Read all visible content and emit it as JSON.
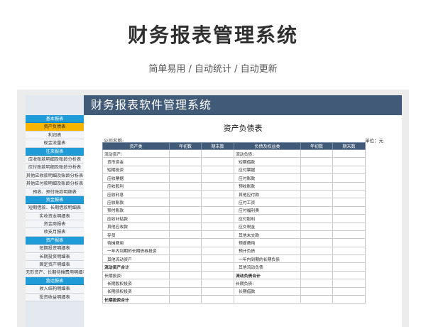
{
  "hero": {
    "title": "财务报表管理系统",
    "subtitle": "简单易用 / 自动统计 / 自动更新"
  },
  "app": {
    "banner_title": "财务报表软件管理系统",
    "sidebar": [
      {
        "label": "基本报表",
        "kind": "header"
      },
      {
        "label": "资产负债表",
        "kind": "active"
      },
      {
        "label": "利润表",
        "kind": "item"
      },
      {
        "label": "现金流量表",
        "kind": "item"
      },
      {
        "label": "往来报表",
        "kind": "header"
      },
      {
        "label": "应收账款明细及账龄分析表",
        "kind": "item"
      },
      {
        "label": "应付账款明细及账龄分析表",
        "kind": "item"
      },
      {
        "label": "其他应收款明细及账龄分析表",
        "kind": "item"
      },
      {
        "label": "其他应付款明细及账龄分析表",
        "kind": "item"
      },
      {
        "label": "预收、预付账款明细表",
        "kind": "item"
      },
      {
        "label": "资金报表",
        "kind": "header"
      },
      {
        "label": "短期借款、长期借款明细表",
        "kind": "item"
      },
      {
        "label": "实收资本明细表",
        "kind": "item"
      },
      {
        "label": "资金周报表",
        "kind": "item"
      },
      {
        "label": "收支月报表",
        "kind": "item"
      },
      {
        "label": "资产报表",
        "kind": "header"
      },
      {
        "label": "短期投资明细表",
        "kind": "item"
      },
      {
        "label": "长期投资明细表",
        "kind": "item"
      },
      {
        "label": "固定资产明细表",
        "kind": "item"
      },
      {
        "label": "无形资产、长期待摊费用明细表",
        "kind": "item"
      },
      {
        "label": "营运报表",
        "kind": "header"
      },
      {
        "label": "收入结构明细表",
        "kind": "item"
      },
      {
        "label": "投资收益明细表",
        "kind": "item"
      }
    ],
    "sheet": {
      "title": "资产负债表",
      "company_label": "公司名称:",
      "unit_label": "单位：元",
      "columns": [
        "资产类",
        "年初数",
        "期末数",
        "负债及权益类",
        "年初数",
        "期末数"
      ],
      "rows": [
        {
          "left": "流动资产:",
          "left_style": "",
          "right": "流动负债:",
          "right_style": ""
        },
        {
          "left": "货币资金",
          "left_style": "ind",
          "right": "短期借款",
          "right_style": "ind"
        },
        {
          "left": "短期投资",
          "left_style": "ind",
          "right": "应付票据",
          "right_style": "ind"
        },
        {
          "left": "应收票据",
          "left_style": "ind",
          "right": "应付账款",
          "right_style": "ind"
        },
        {
          "left": "应收股利",
          "left_style": "ind",
          "right": "预收账款",
          "right_style": "ind"
        },
        {
          "left": "应收利息",
          "left_style": "ind",
          "right": "其他应付款",
          "right_style": "ind"
        },
        {
          "left": "应收账款",
          "left_style": "ind",
          "right": "应付工资",
          "right_style": "ind"
        },
        {
          "left": "预付账款",
          "left_style": "ind",
          "right": "应付福利费",
          "right_style": "ind"
        },
        {
          "left": "应收补贴款",
          "left_style": "ind",
          "right": "应付股利",
          "right_style": "ind"
        },
        {
          "left": "其他应收款",
          "left_style": "ind",
          "right": "应交税金",
          "right_style": "ind"
        },
        {
          "left": "存货",
          "left_style": "ind",
          "right": "其他未交款",
          "right_style": "ind"
        },
        {
          "left": "待摊费用",
          "left_style": "ind",
          "right": "预提费用",
          "right_style": "ind"
        },
        {
          "left": "一年内到期的长期债券投资",
          "left_style": "ind",
          "right": "预计负债",
          "right_style": "ind"
        },
        {
          "left": "其他流动资产",
          "left_style": "ind",
          "right": "一年内到期的长期负债",
          "right_style": "ind"
        },
        {
          "left": "流动资产合计",
          "left_style": "b",
          "right": "其他流动负债",
          "right_style": "ind"
        },
        {
          "left": "长期投资:",
          "left_style": "",
          "right": "流动负债合计",
          "right_style": "b"
        },
        {
          "left": "长期股权投资",
          "left_style": "ind",
          "right": "长期负债:",
          "right_style": ""
        },
        {
          "left": "长期债权投资",
          "left_style": "ind",
          "right": "长期借款",
          "right_style": "ind"
        },
        {
          "left": "长期投资合计",
          "left_style": "b",
          "right": "",
          "right_style": ""
        }
      ]
    }
  }
}
